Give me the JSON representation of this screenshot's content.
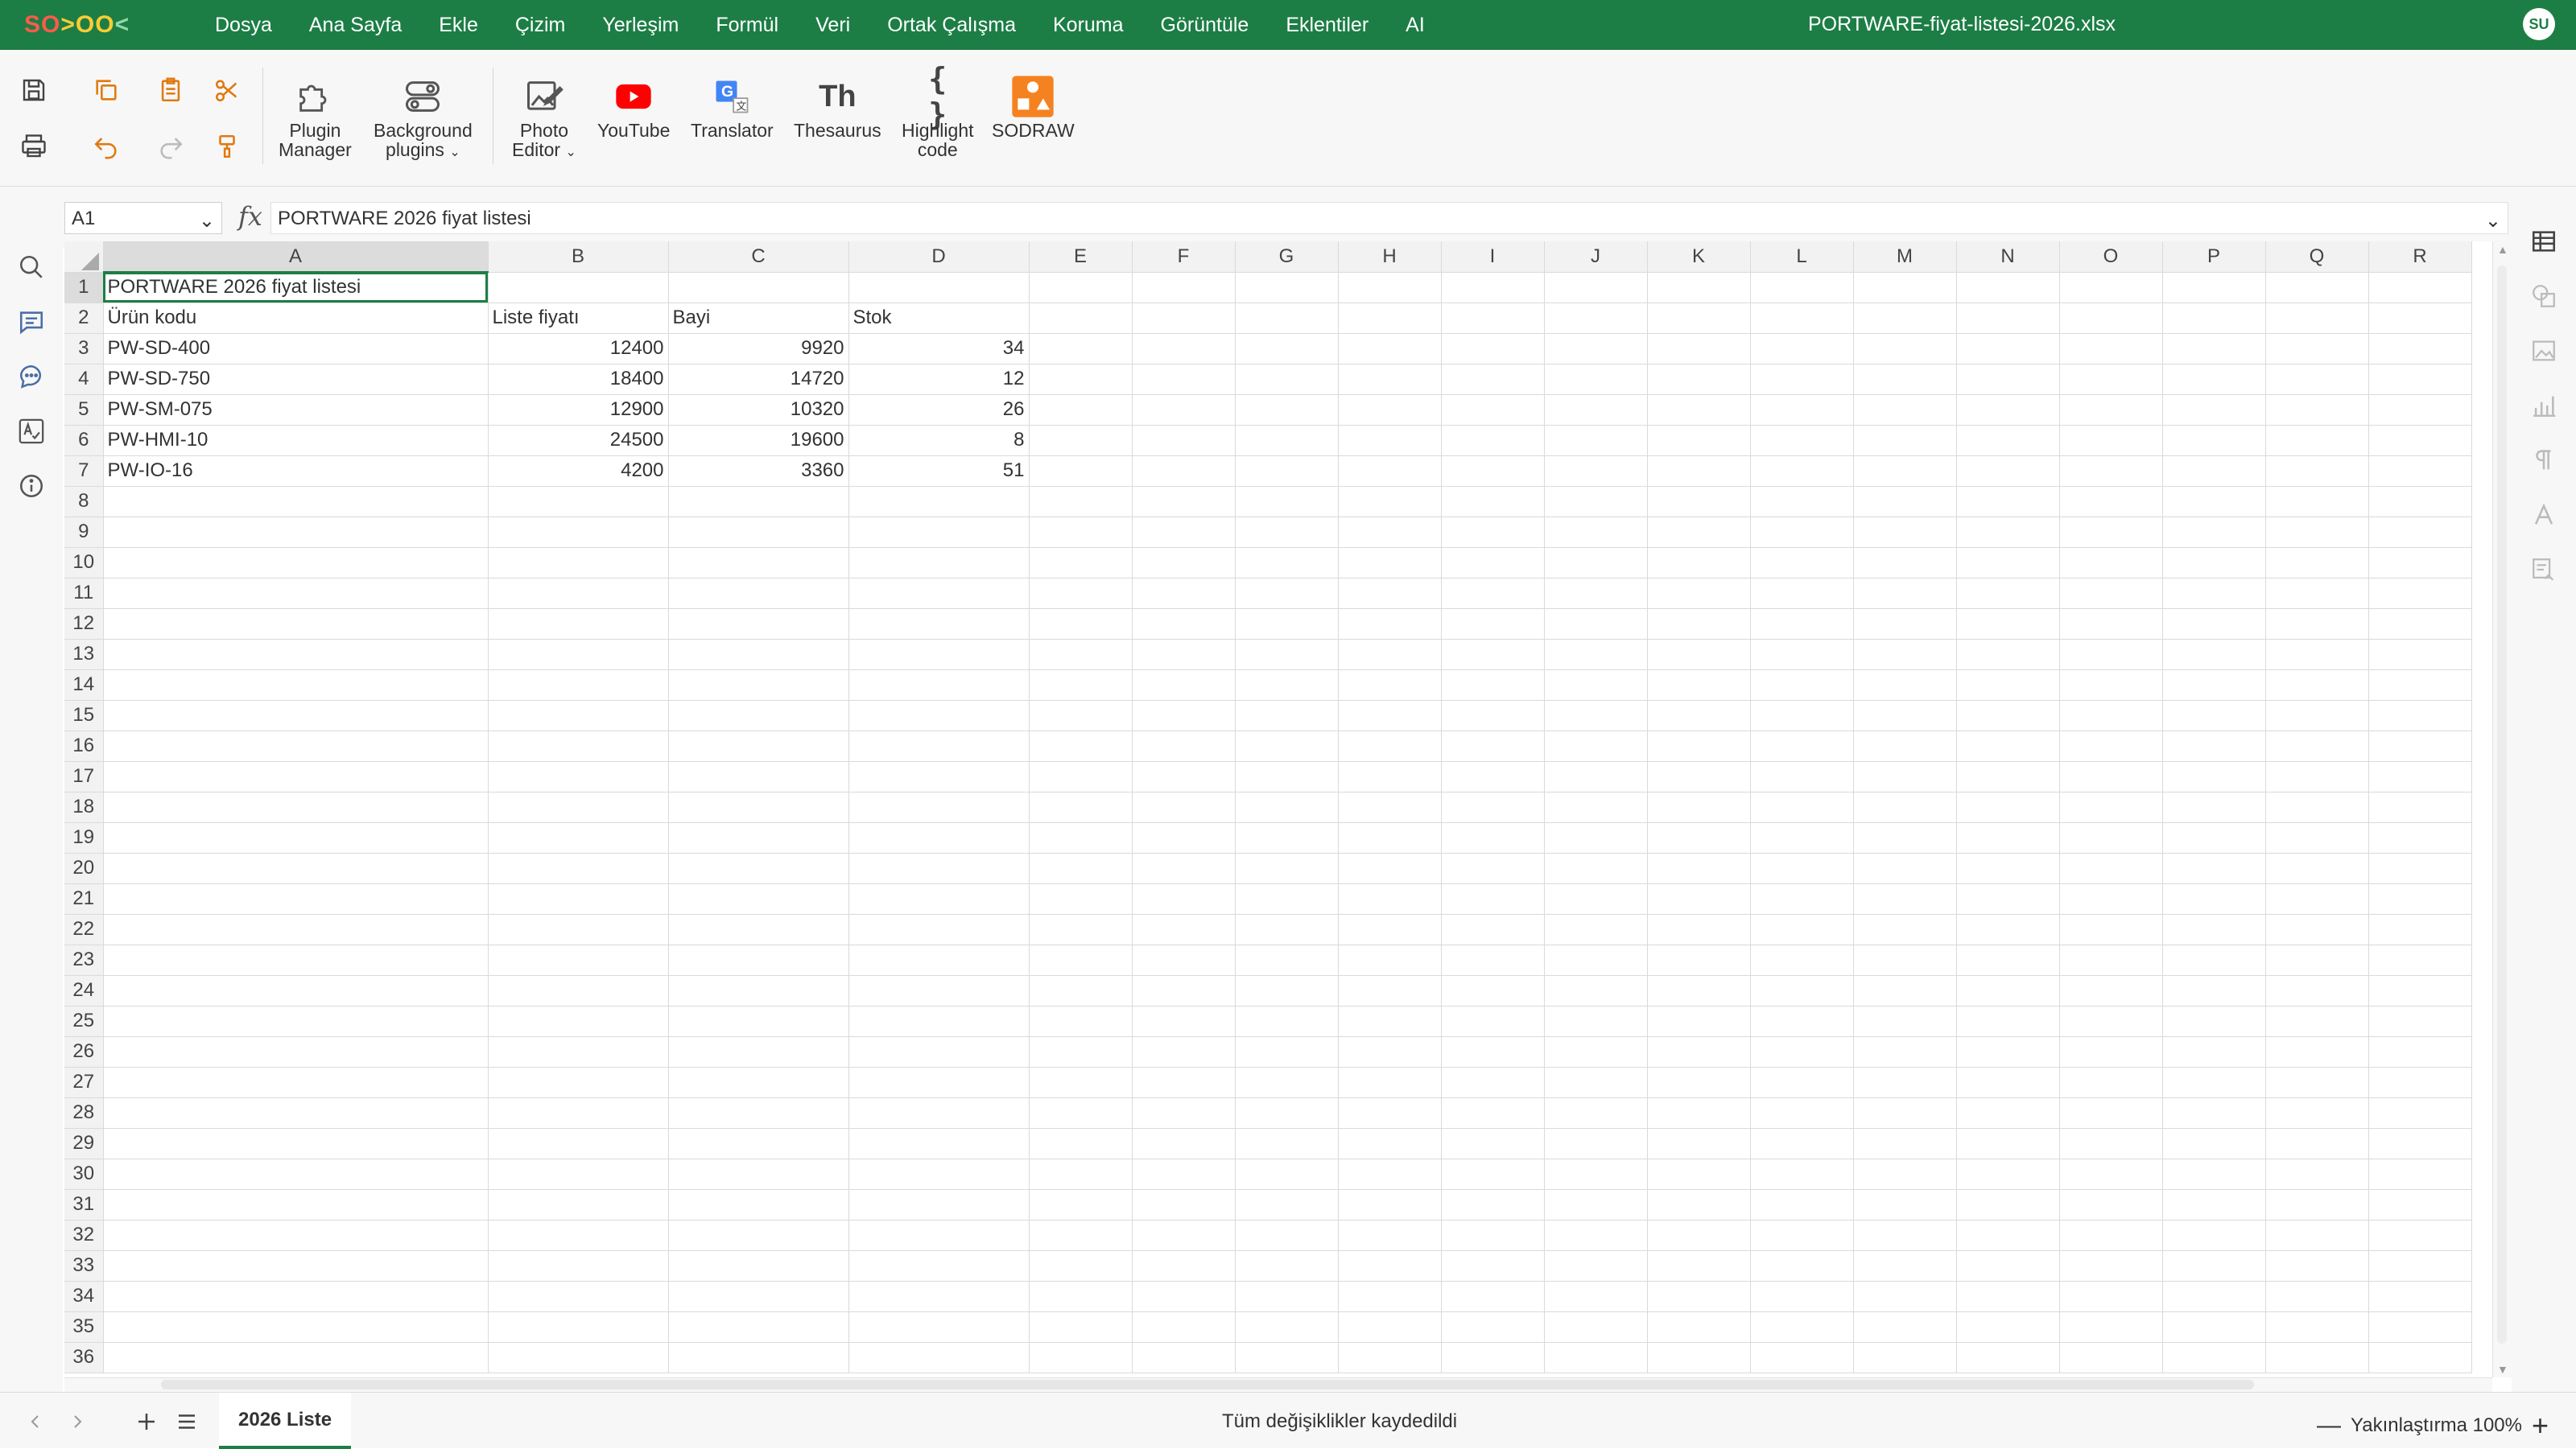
{
  "app": {
    "logo_parts": [
      "SO",
      ">",
      "OO",
      "<"
    ],
    "user_initials": "SU"
  },
  "menu": [
    "Dosya",
    "Ana Sayfa",
    "Ekle",
    "Çizim",
    "Yerleşim",
    "Formül",
    "Veri",
    "Ortak Çalışma",
    "Koruma",
    "Görüntüle",
    "Eklentiler",
    "AI"
  ],
  "document_title": "PORTWARE-fiyat-listesi-2026.xlsx",
  "ribbon": {
    "plugin_manager": [
      "Plugin",
      "Manager"
    ],
    "background_plugins": [
      "Background",
      "plugins"
    ],
    "photo_editor": [
      "Photo",
      "Editor"
    ],
    "youtube": "YouTube",
    "translator": "Translator",
    "thesaurus": "Thesaurus",
    "thesaurus_glyph": "Th",
    "highlight_code": [
      "Highlight",
      "code"
    ],
    "highlight_glyph": "{ }",
    "sodraw": "SODRAW"
  },
  "formula_bar": {
    "cell_ref": "A1",
    "fx": "fx",
    "content": "PORTWARE 2026 fiyat listesi"
  },
  "columns": [
    "A",
    "B",
    "C",
    "D",
    "E",
    "F",
    "G",
    "H",
    "I",
    "J",
    "K",
    "L",
    "M",
    "N",
    "O",
    "P",
    "Q",
    "R"
  ],
  "rows": [
    [
      "PORTWARE 2026 fiyat listesi",
      "",
      "",
      ""
    ],
    [
      "Ürün kodu",
      "Liste fiyatı",
      "Bayi",
      "Stok"
    ],
    [
      "PW-SD-400",
      "12400",
      "9920",
      "34"
    ],
    [
      "PW-SD-750",
      "18400",
      "14720",
      "12"
    ],
    [
      "PW-SM-075",
      "12900",
      "10320",
      "26"
    ],
    [
      "PW-HMI-10",
      "24500",
      "19600",
      "8"
    ],
    [
      "PW-IO-16",
      "4200",
      "3360",
      "51"
    ]
  ],
  "row_count": 36,
  "sheet_tab": "2026 Liste",
  "status": {
    "save_text": "Tüm değişiklikler kaydedildi",
    "zoom_label": "Yakınlaştırma 100%"
  },
  "colors": {
    "brand": "#1c7e45",
    "youtube": "#ff0000",
    "translator": "#4285f4",
    "sodraw": "#f58220"
  }
}
